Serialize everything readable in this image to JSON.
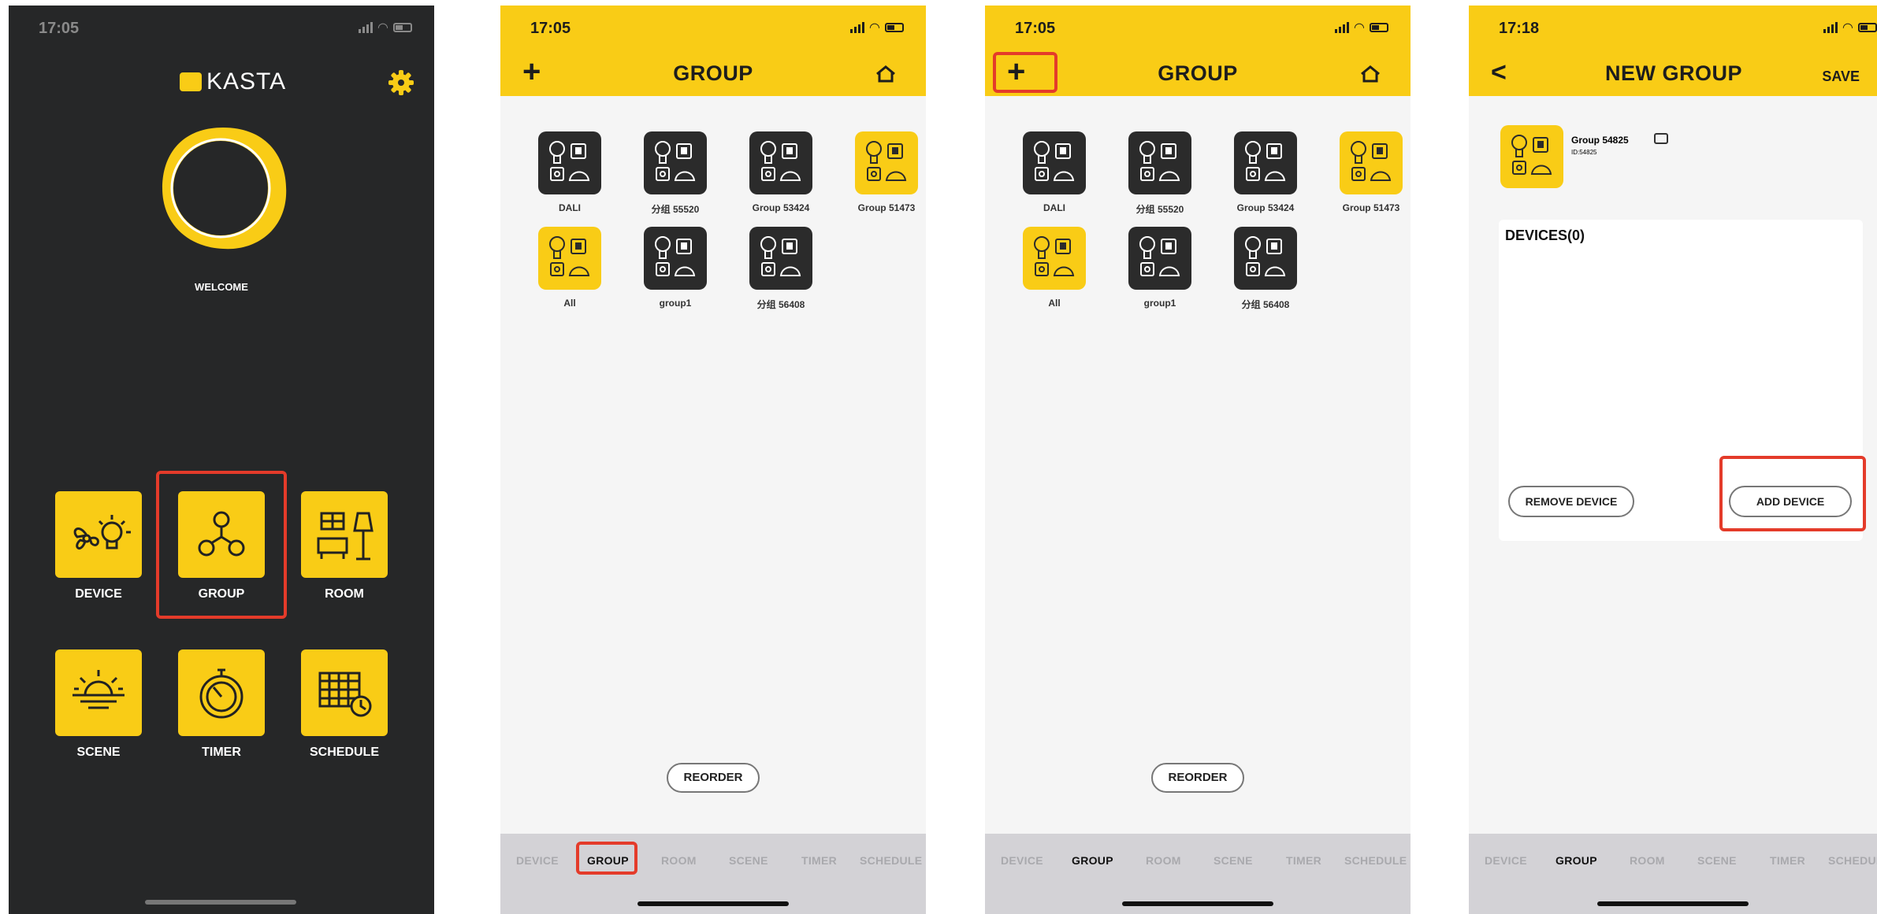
{
  "screens": [
    {
      "status_time": "17:05",
      "logo_text": "KASTA",
      "welcome": "WELCOME",
      "menu": [
        "DEVICE",
        "GROUP",
        "ROOM",
        "SCENE",
        "TIMER",
        "SCHEDULE"
      ]
    },
    {
      "status_time": "17:05",
      "title": "GROUP",
      "tiles": [
        "DALI",
        "分组 55520",
        "Group 53424",
        "Group 51473",
        "All",
        "group1",
        "分组 56408"
      ],
      "reorder": "REORDER",
      "tabs": [
        "DEVICE",
        "GROUP",
        "ROOM",
        "SCENE",
        "TIMER",
        "SCHEDULE"
      ],
      "active_tab": "GROUP"
    },
    {
      "status_time": "17:05",
      "title": "GROUP",
      "tiles": [
        "DALI",
        "分组 55520",
        "Group 53424",
        "Group 51473",
        "All",
        "group1",
        "分组 56408"
      ],
      "reorder": "REORDER",
      "tabs": [
        "DEVICE",
        "GROUP",
        "ROOM",
        "SCENE",
        "TIMER",
        "SCHEDULE"
      ],
      "active_tab": "GROUP"
    },
    {
      "status_time": "17:18",
      "title": "NEW GROUP",
      "save": "SAVE",
      "group_name": "Group 54825",
      "group_id": "ID:54825",
      "devices_heading": "DEVICES(0)",
      "remove_device": "REMOVE DEVICE",
      "add_device": "ADD DEVICE",
      "tabs": [
        "DEVICE",
        "GROUP",
        "ROOM",
        "SCENE",
        "TIMER",
        "SCHEDULE"
      ],
      "active_tab": "GROUP"
    }
  ],
  "colors": {
    "accent": "#f9cc16",
    "dark_bg": "#262728",
    "highlight": "#e43b2a"
  }
}
